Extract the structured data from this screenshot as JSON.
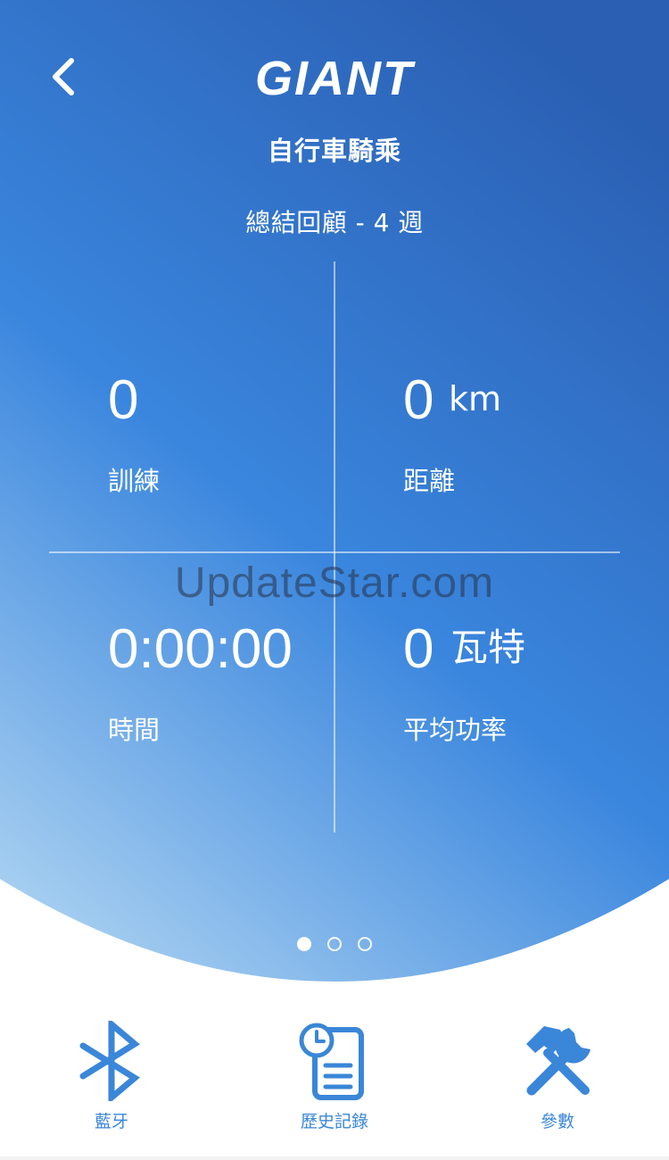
{
  "header": {
    "logo_text": "GIANT",
    "page_title": "自行車騎乘",
    "summary_title": "總結回顧 - 4 週"
  },
  "stats": {
    "trainings": {
      "value": "0",
      "unit": "",
      "label": "訓練"
    },
    "distance": {
      "value": "0",
      "unit": "km",
      "label": "距離"
    },
    "time": {
      "value": "0:00:00",
      "unit": "",
      "label": "時間"
    },
    "avg_power": {
      "value": "0",
      "unit": "瓦特",
      "label": "平均功率"
    }
  },
  "watermark": "UpdateStar.com",
  "pager": {
    "count": 3,
    "active_index": 0
  },
  "tabbar": {
    "bluetooth": {
      "label": "藍牙",
      "icon": "bluetooth-icon"
    },
    "history": {
      "label": "歷史記錄",
      "icon": "clock-document-icon"
    },
    "settings": {
      "label": "參數",
      "icon": "wrench-hammer-icon"
    }
  },
  "colors": {
    "gradient_top": "#2a62b6",
    "gradient_mid": "#3a86de",
    "gradient_bottom": "#9cc8ee",
    "accent": "#3a86d8",
    "text_on_blue": "#ffffff"
  }
}
